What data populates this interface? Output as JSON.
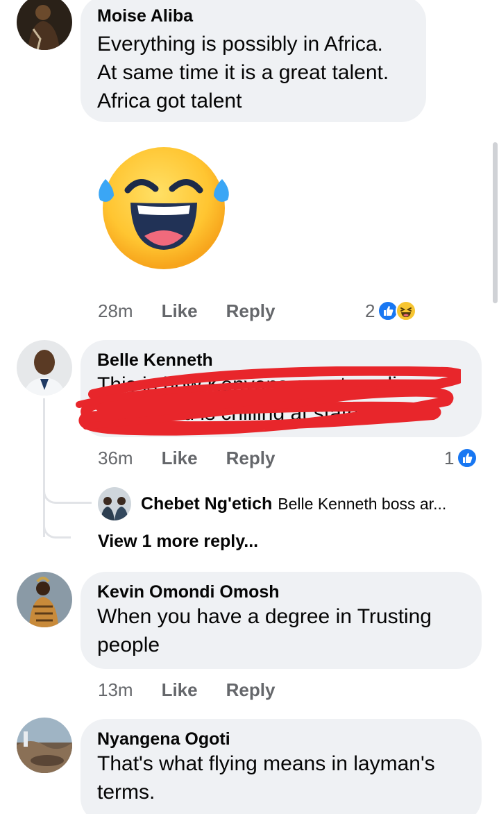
{
  "colors": {
    "accent": "#1877f2",
    "bubble": "#eff1f4",
    "meta": "#65676b",
    "redaction": "#e8262b"
  },
  "comments": [
    {
      "author": "Moise Aliba",
      "lines": [
        "Everything is possibly in Africa.",
        "At same time it is a great talent.",
        "Africa got talent"
      ],
      "sticker": "laughing-tears-emoji",
      "time": "28m",
      "like": "Like",
      "reply": "Reply",
      "reaction_count": "2",
      "reactions": [
        "like-icon",
        "haha-icon"
      ]
    },
    {
      "author": "Belle Kenneth",
      "lines": [
        "This is how Kenyans are struggling",
        "and Uhuru is chilling at state house."
      ],
      "redacted": true,
      "time": "36m",
      "like": "Like",
      "reply": "Reply",
      "reaction_count": "1",
      "reactions": [
        "like-icon"
      ],
      "reply_preview": {
        "author": "Chebet Ng'etich",
        "text": "Belle Kenneth boss ar..."
      },
      "view_more": "View 1 more reply..."
    },
    {
      "author": "Kevin Omondi Omosh",
      "lines": [
        "When you have a degree in Trusting",
        "people"
      ],
      "time": "13m",
      "like": "Like",
      "reply": "Reply"
    },
    {
      "author": "Nyangena Ogoti",
      "lines": [
        "That's what flying means in layman's",
        "terms."
      ]
    }
  ]
}
